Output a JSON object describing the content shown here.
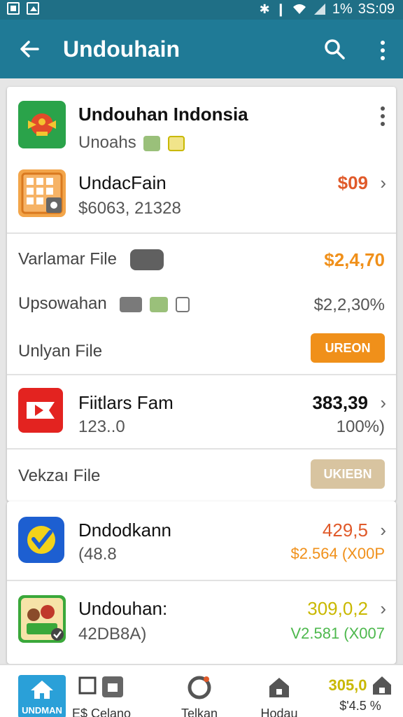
{
  "status_bar": {
    "battery": "1%",
    "time": "3S:09"
  },
  "app_bar": {
    "title": "Undouhain"
  },
  "rows": {
    "r1": {
      "title": "Undouhan Indonsia",
      "subtitle": "Unoahs"
    },
    "r2": {
      "title": "UndacFain",
      "subtitle": "$6063, 21328",
      "value": "$09"
    },
    "r3": {
      "label": "Varlamar File",
      "value": "$2,4,70"
    },
    "r4": {
      "label": "Upsowahan",
      "value": "$2,2,30%"
    },
    "r5": {
      "label": "Unlyan File",
      "button": "UREON"
    },
    "r6": {
      "title": "Fiitlars Fam",
      "subtitle": "123..0",
      "value": "383,39",
      "value2": "100%)"
    },
    "r7": {
      "label": "Vekzaı File",
      "button": "UKIEBN"
    },
    "r8": {
      "title": "Dndodkann",
      "subtitle": "(48.8",
      "value": "429,5",
      "value2": "$2.564 (X00P"
    },
    "r9": {
      "title": "Undouhan:",
      "subtitle": "42DB8A)",
      "value": "309,0,2",
      "value2": "V2.581 (X007"
    }
  },
  "bottom_nav": {
    "home": "UNDMAN",
    "n2": "E$ Celano",
    "n3": "Telkan",
    "n4": "Hodau",
    "n5_value": "305,0",
    "n5_label": "$'4.5 %"
  },
  "colors": {
    "app_bar": "#1f7a96",
    "orange": "#f0901a",
    "beige_button": "#d8c4a0",
    "red_accent": "#e05a2a",
    "yellow_accent": "#c9b800",
    "green_accent": "#4db84d"
  }
}
